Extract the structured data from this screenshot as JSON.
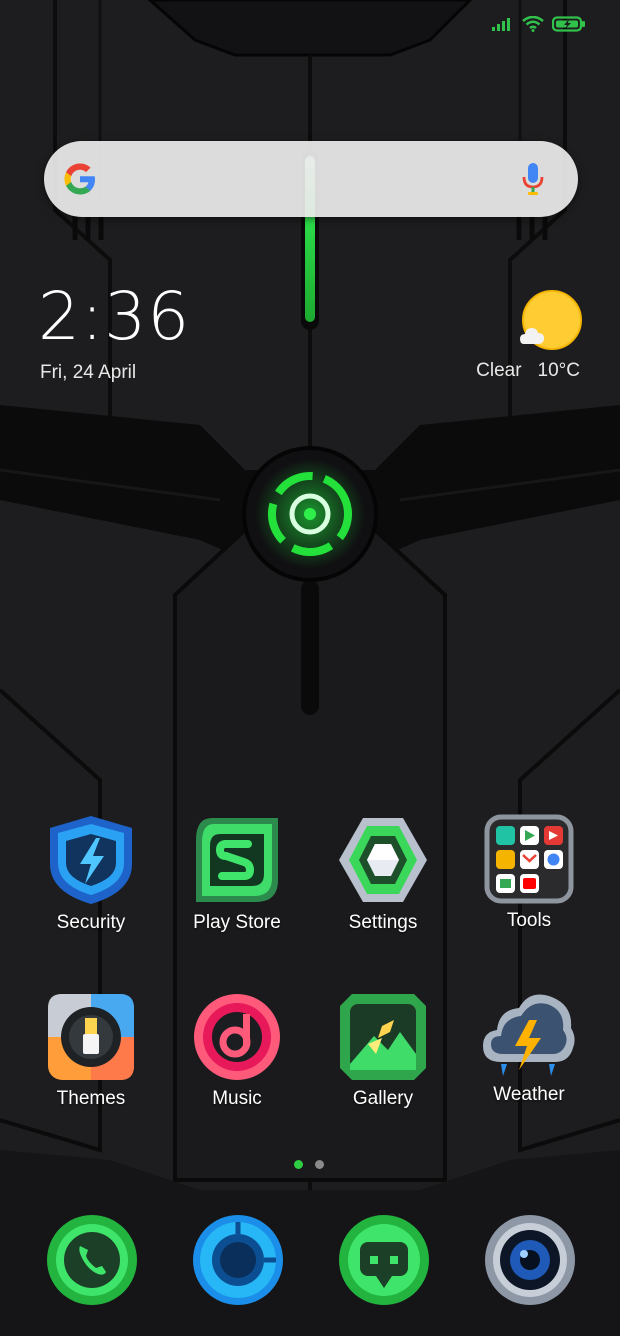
{
  "status_bar": {
    "icons": [
      "signal-icon",
      "wifi-icon",
      "battery-charging-icon"
    ],
    "accent": "#31c24b"
  },
  "search": {
    "placeholder": "",
    "icons": [
      "google-logo-icon",
      "microphone-icon"
    ]
  },
  "clock": {
    "time": "2:36",
    "date": "Fri, 24 April"
  },
  "weather_widget": {
    "condition": "Clear",
    "temperature": "10°C",
    "icon": "sun-cloud-icon"
  },
  "apps": [
    {
      "label": "Security",
      "icon": "security-shield-icon"
    },
    {
      "label": "Play Store",
      "icon": "play-store-icon"
    },
    {
      "label": "Settings",
      "icon": "settings-hexagon-icon"
    },
    {
      "label": "Tools",
      "icon": "tools-folder-icon"
    },
    {
      "label": "Themes",
      "icon": "themes-brush-icon"
    },
    {
      "label": "Music",
      "icon": "music-icon"
    },
    {
      "label": "Gallery",
      "icon": "gallery-icon"
    },
    {
      "label": "Weather",
      "icon": "weather-storm-icon"
    }
  ],
  "page_indicator": {
    "pages": 2,
    "current": 1,
    "active_color": "#2ecc40",
    "inactive_color": "#8a8a8a"
  },
  "dock": [
    {
      "icon": "phone-icon"
    },
    {
      "icon": "browser-icon"
    },
    {
      "icon": "messages-icon"
    },
    {
      "icon": "camera-icon"
    }
  ],
  "colors": {
    "wallpaper": "#1d1d1f",
    "glow": "#1fe03a"
  }
}
